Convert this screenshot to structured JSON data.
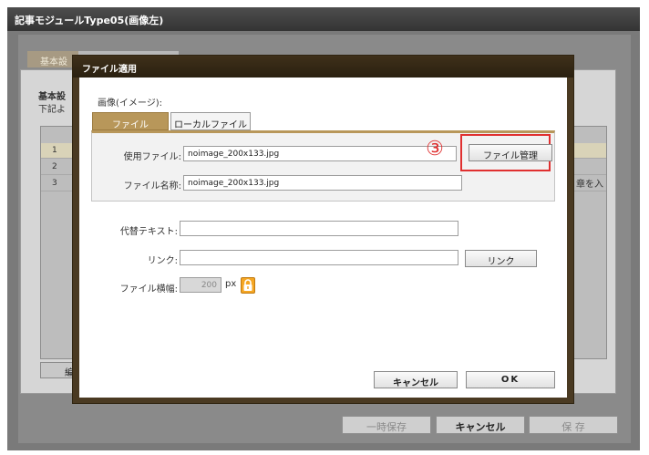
{
  "window": {
    "title": "記事モジュールType05(画像左)"
  },
  "background": {
    "tab_label": "基本設",
    "heading": "基本設",
    "description": "下記よ",
    "row_numbers": [
      "1",
      "2",
      "3"
    ],
    "edge_text": "章を入",
    "edit_button": "編",
    "buttons": {
      "temp_save": "一時保存",
      "cancel": "キャンセル",
      "save": "保 存"
    }
  },
  "dialog": {
    "title": "ファイル適用",
    "image_label": "画像(イメージ):",
    "tabs": [
      {
        "label": "ファイル",
        "active": true
      },
      {
        "label": "ローカルファイル",
        "active": false
      }
    ],
    "fields": {
      "use_file_label": "使用ファイル:",
      "use_file_value": "noimage_200x133.jpg",
      "file_name_label": "ファイル名称:",
      "file_name_value": "noimage_200x133.jpg",
      "alt_label": "代替テキスト:",
      "alt_value": "",
      "link_label": "リンク:",
      "link_value": "",
      "width_label": "ファイル横幅:",
      "width_value": "200",
      "width_unit": "px"
    },
    "buttons": {
      "manage": "ファイル管理",
      "link": "リンク",
      "cancel": "キャンセル",
      "ok": "OK"
    },
    "annotation": {
      "marker": "③",
      "color": "#e03030"
    },
    "icons": {
      "lock": "lock-icon"
    }
  }
}
